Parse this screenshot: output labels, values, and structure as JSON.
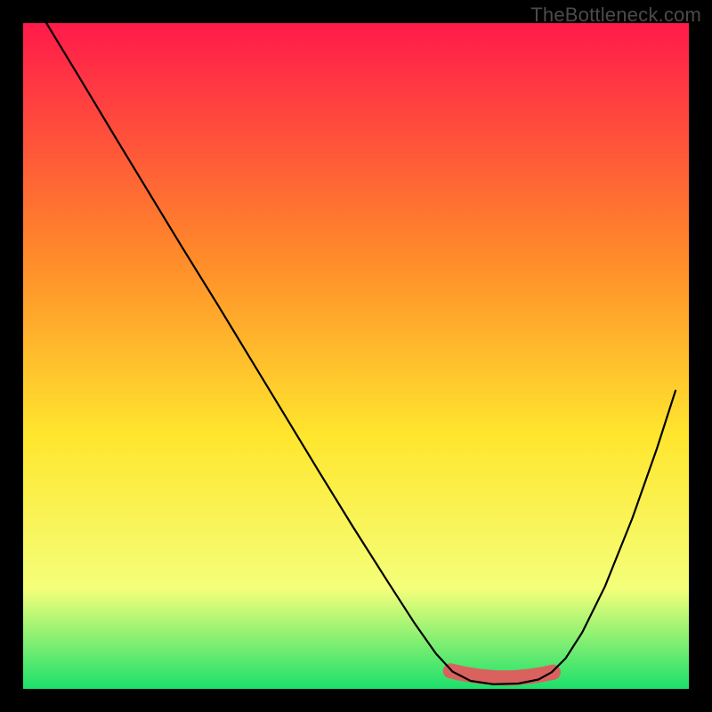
{
  "watermark": "TheBottleneck.com",
  "colors": {
    "frame": "#000000",
    "gradient_top": "#ff1a4b",
    "gradient_mid1": "#ff8a2a",
    "gradient_mid2": "#ffe62e",
    "gradient_mid3": "#f4ff7a",
    "gradient_bottom": "#1be06b",
    "curve": "#000000",
    "marker_fill": "#d9625f",
    "marker_stroke": "#d9625f"
  },
  "chart_data": {
    "type": "line",
    "title": "",
    "xlabel": "",
    "ylabel": "",
    "xlim": [
      0,
      100
    ],
    "ylim": [
      0,
      100
    ],
    "curve_points": [
      {
        "x": 3.5,
        "y": 100.0
      },
      {
        "x": 8.6,
        "y": 91.6
      },
      {
        "x": 13.7,
        "y": 83.1
      },
      {
        "x": 18.8,
        "y": 74.7
      },
      {
        "x": 23.9,
        "y": 66.3
      },
      {
        "x": 29.1,
        "y": 57.9
      },
      {
        "x": 34.2,
        "y": 49.5
      },
      {
        "x": 39.3,
        "y": 41.1
      },
      {
        "x": 44.4,
        "y": 32.7
      },
      {
        "x": 49.5,
        "y": 24.4
      },
      {
        "x": 54.7,
        "y": 16.2
      },
      {
        "x": 58.7,
        "y": 10.0
      },
      {
        "x": 62.0,
        "y": 5.3
      },
      {
        "x": 64.5,
        "y": 2.6
      },
      {
        "x": 67.2,
        "y": 1.2
      },
      {
        "x": 70.6,
        "y": 0.7
      },
      {
        "x": 74.4,
        "y": 0.8
      },
      {
        "x": 77.4,
        "y": 1.4
      },
      {
        "x": 79.4,
        "y": 2.5
      },
      {
        "x": 81.5,
        "y": 4.6
      },
      {
        "x": 84.0,
        "y": 8.5
      },
      {
        "x": 87.4,
        "y": 15.4
      },
      {
        "x": 91.5,
        "y": 25.6
      },
      {
        "x": 95.2,
        "y": 36.1
      },
      {
        "x": 98.0,
        "y": 44.8
      }
    ],
    "marker_region": {
      "start": {
        "x": 64.2,
        "y": 2.7
      },
      "mid": {
        "x": 72.0,
        "y": 0.7
      },
      "end": {
        "x": 79.6,
        "y": 2.5
      }
    }
  }
}
